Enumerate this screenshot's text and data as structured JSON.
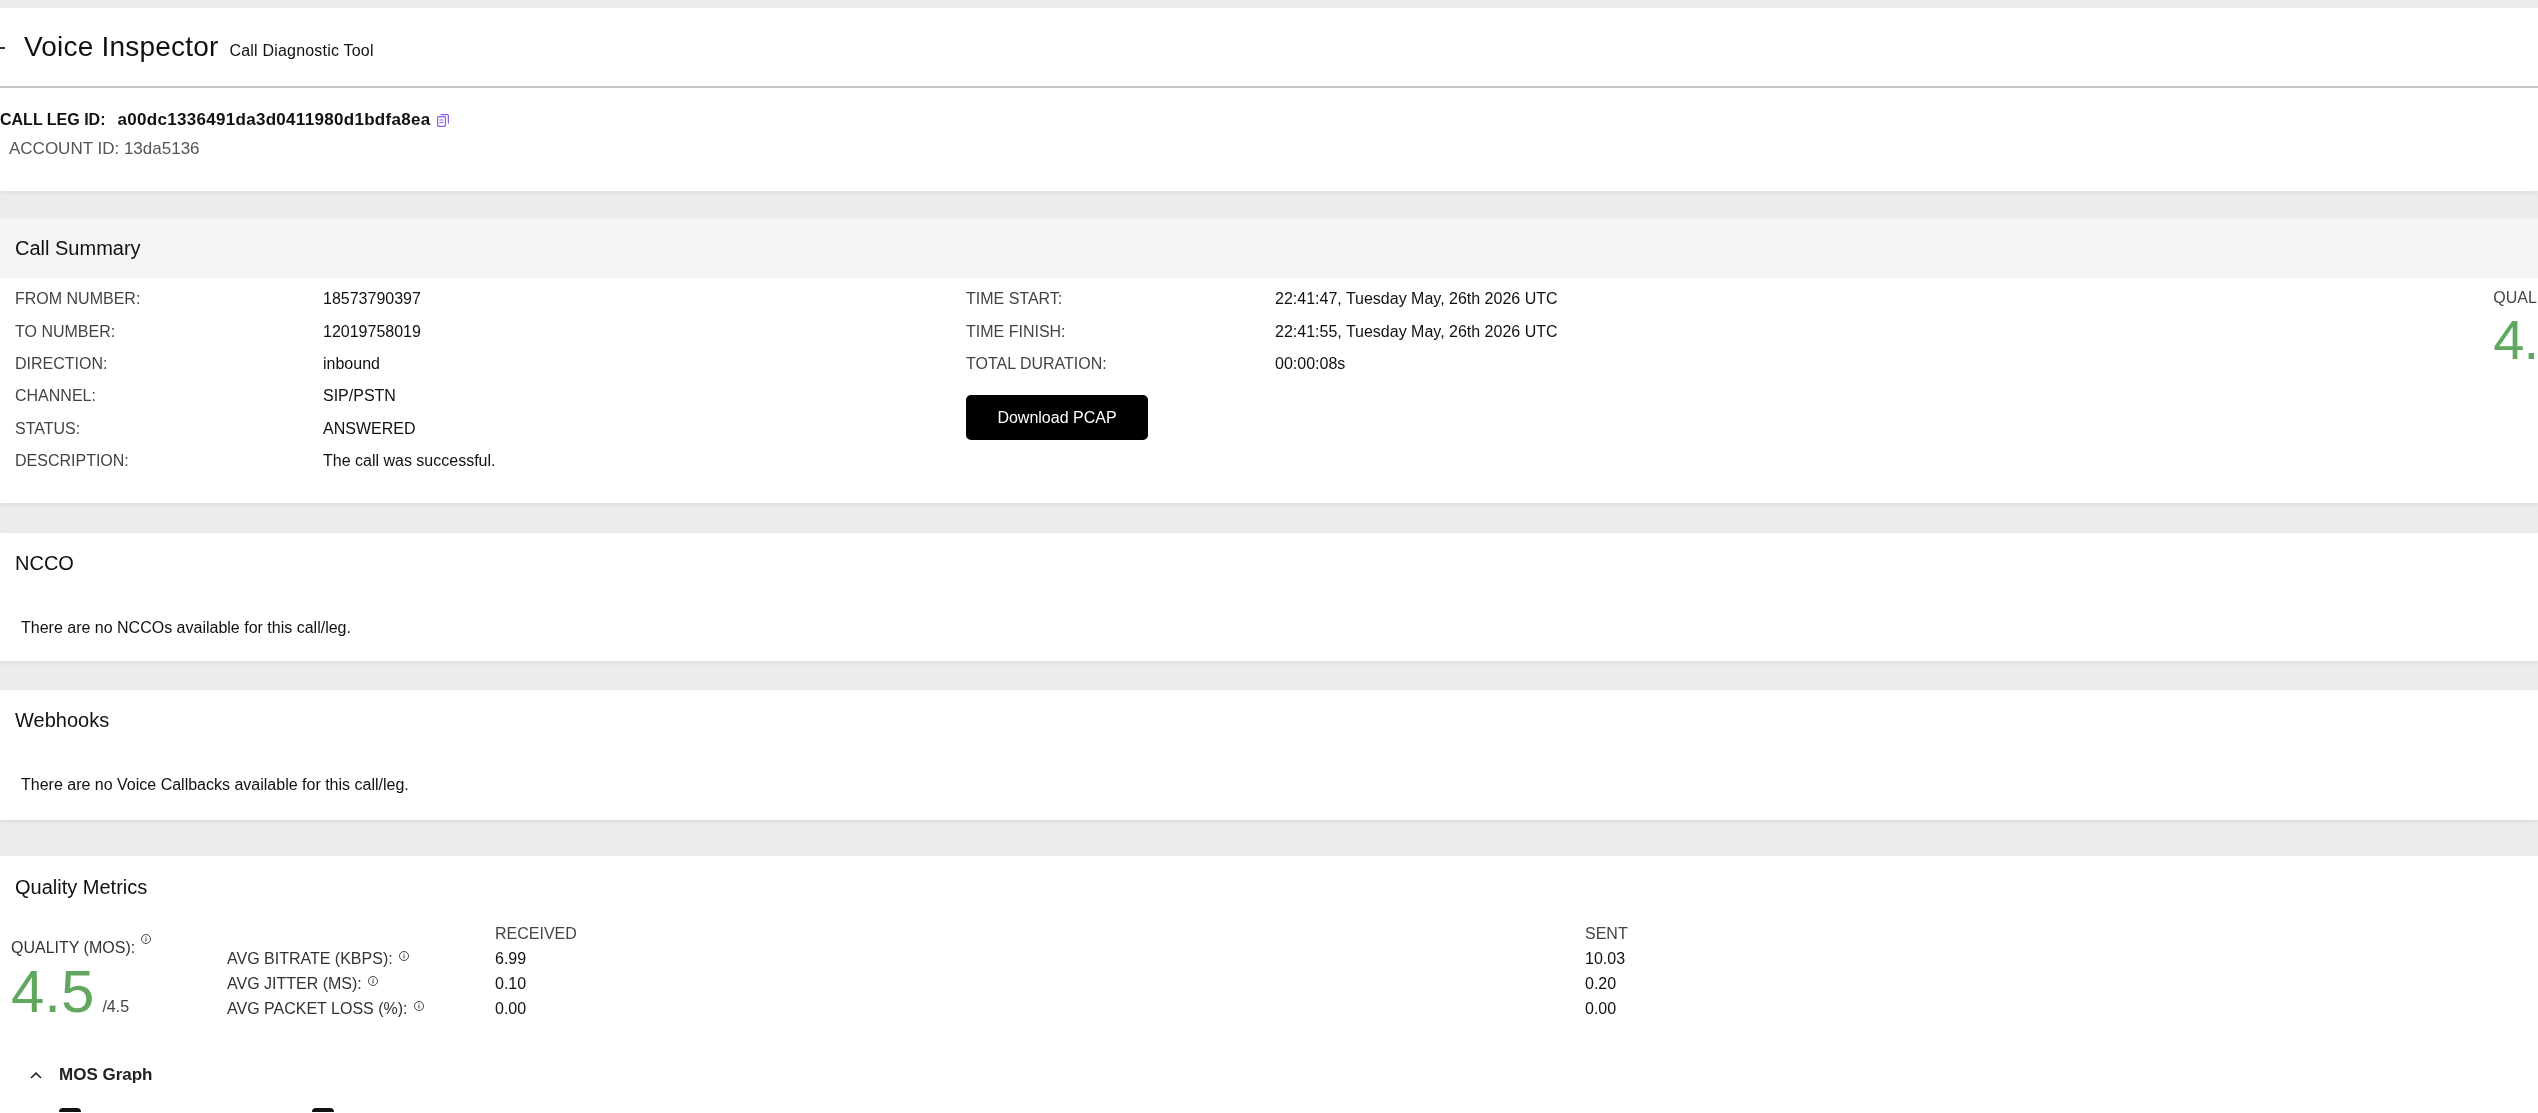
{
  "header": {
    "title": "Voice Inspector",
    "subtitle": "Call Diagnostic Tool"
  },
  "call_info": {
    "call_leg_label": "CALL LEG ID:",
    "call_leg_id": "a00dc1336491da3d0411980d1bdfa8ea",
    "account_id": "ACCOUNT ID: 13da5136"
  },
  "call_summary": {
    "title": "Call Summary",
    "left_fields": [
      {
        "label": "FROM NUMBER:",
        "value": "18573790397"
      },
      {
        "label": "TO NUMBER:",
        "value": "12019758019"
      },
      {
        "label": "DIRECTION:",
        "value": "inbound"
      },
      {
        "label": "CHANNEL:",
        "value": "SIP/PSTN"
      },
      {
        "label": "STATUS:",
        "value": "ANSWERED"
      },
      {
        "label": "DESCRIPTION:",
        "value": "The call was successful."
      }
    ],
    "right_fields": [
      {
        "label": "TIME START:",
        "value": "22:41:47, Tuesday May, 26th 2026 UTC"
      },
      {
        "label": "TIME FINISH:",
        "value": "22:41:55, Tuesday May, 26th 2026 UTC"
      },
      {
        "label": "TOTAL DURATION:",
        "value": "00:00:08s"
      }
    ],
    "download_button": "Download PCAP",
    "quality": {
      "label": "QUAL",
      "value": "4."
    }
  },
  "ncco": {
    "title": "NCCO",
    "message": "There are no NCCOs available for this call/leg."
  },
  "webhooks": {
    "title": "Webhooks",
    "message": "There are no Voice Callbacks available for this call/leg."
  },
  "quality_metrics": {
    "title": "Quality Metrics",
    "mos": {
      "label": "QUALITY (MOS):",
      "value": "4.5",
      "max": "/4.5"
    },
    "columns": [
      "RECEIVED",
      "SENT"
    ],
    "rows": [
      {
        "label": "AVG BITRATE (KBPS):",
        "received": "6.99",
        "sent": "10.03"
      },
      {
        "label": "AVG JITTER (MS):",
        "received": "0.10",
        "sent": "0.20"
      },
      {
        "label": "AVG PACKET LOSS (%):",
        "received": "0.00",
        "sent": "0.00"
      }
    ],
    "mos_graph": {
      "label": "MOS Graph",
      "expanded": true,
      "series_toggles": [
        {
          "checked": true
        },
        {
          "checked": true
        }
      ]
    }
  }
}
